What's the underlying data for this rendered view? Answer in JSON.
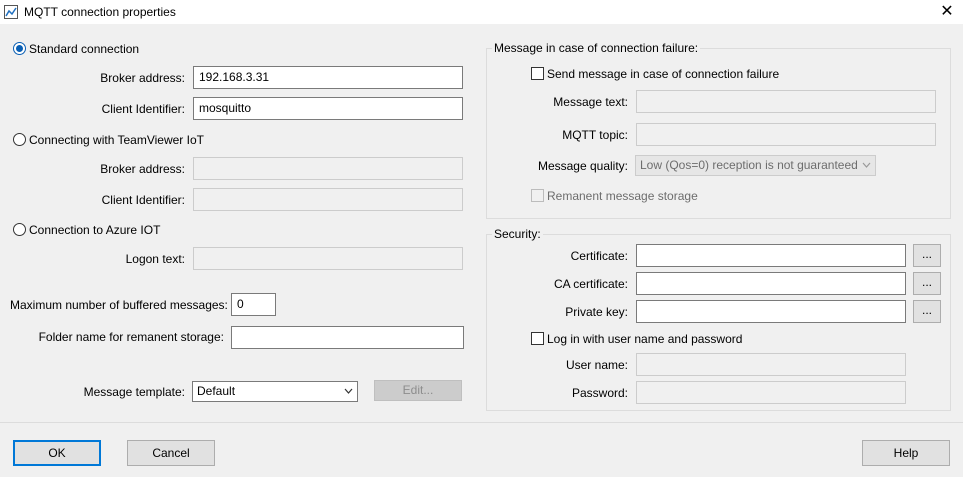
{
  "window": {
    "title": "MQTT connection properties",
    "close_glyph": "✕",
    "app_icon": "chart-app-icon"
  },
  "left": {
    "standard_connection": {
      "label": "Standard connection",
      "selected": true,
      "broker_address_label": "Broker address:",
      "broker_address_value": "192.168.3.31",
      "client_id_label": "Client Identifier:",
      "client_id_value": "mosquitto"
    },
    "teamviewer": {
      "label": "Connecting with TeamViewer IoT",
      "selected": false,
      "broker_address_label": "Broker address:",
      "broker_address_value": "",
      "client_id_label": "Client Identifier:",
      "client_id_value": ""
    },
    "azure": {
      "label": "Connection to Azure IOT",
      "selected": false,
      "logon_text_label": "Logon text:",
      "logon_text_value": ""
    },
    "max_buffered_label": "Maximum number of buffered messages:",
    "max_buffered_value": "0",
    "folder_label": "Folder name for remanent storage:",
    "folder_value": "",
    "template_label": "Message template:",
    "template_value": "Default",
    "edit_button": "Edit..."
  },
  "failure_group": {
    "title": "Message in case of connection failure:",
    "send_message_label": "Send message in case of connection failure",
    "send_message_checked": false,
    "message_text_label": "Message text:",
    "message_text_value": "",
    "topic_label": "MQTT topic:",
    "topic_value": "",
    "quality_label": "Message quality:",
    "quality_value": "Low (Qos=0) reception is not guaranteed",
    "remanent_label": "Remanent message storage",
    "remanent_checked": false
  },
  "security_group": {
    "title": "Security:",
    "certificate_label": "Certificate:",
    "certificate_value": "",
    "ca_certificate_label": "CA certificate:",
    "ca_certificate_value": "",
    "private_key_label": "Private key:",
    "private_key_value": "",
    "browse_label": "...",
    "login_label": "Log in with user name and password",
    "login_checked": false,
    "username_label": "User name:",
    "username_value": "",
    "password_label": "Password:",
    "password_value": ""
  },
  "footer": {
    "ok": "OK",
    "cancel": "Cancel",
    "help": "Help"
  },
  "colors": {
    "background": "#f0f0f0",
    "accent": "#0078d7"
  }
}
